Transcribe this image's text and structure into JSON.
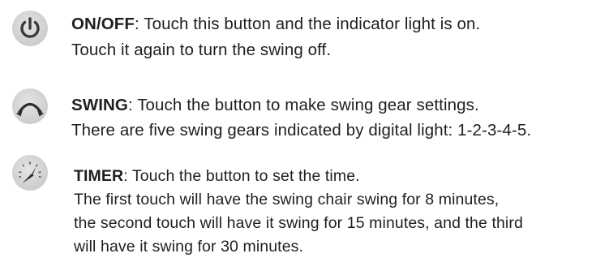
{
  "onoff": {
    "icon": "power-icon",
    "label": "ON/OFF",
    "line1": ": Touch this button and the indicator light is on.",
    "line2": "Touch it again to turn the swing off."
  },
  "swing": {
    "icon": "swing-arc-icon",
    "label": "SWING",
    "line1": ": Touch the button to make swing gear settings.",
    "line2": "There are five swing gears indicated by digital light:  1-2-3-4-5."
  },
  "timer": {
    "icon": "timer-gauge-icon",
    "label": "TIMER",
    "line1": ": Touch the button to set the time.",
    "line2": "The first touch will have the swing chair swing for 8 minutes,",
    "line3": "the second touch will have it swing for 15 minutes, and the third",
    "line4": "will have it swing for 30 minutes."
  }
}
